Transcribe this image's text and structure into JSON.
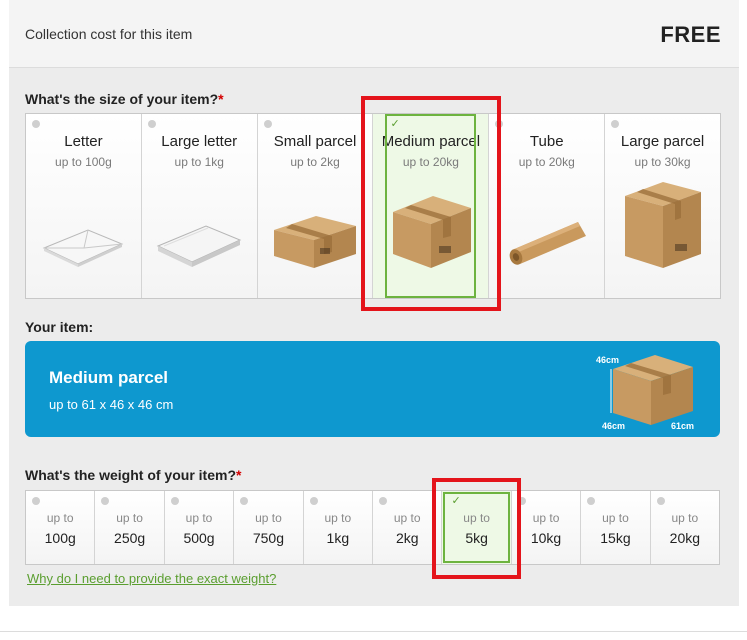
{
  "collection": {
    "label": "Collection cost for this item",
    "value": "FREE"
  },
  "size_section": {
    "title": "What's the size of your item?",
    "required_mark": "*"
  },
  "sizes": [
    {
      "name": "Letter",
      "limit": "up to 100g",
      "icon": "envelope-icon",
      "selected": false
    },
    {
      "name": "Large letter",
      "limit": "up to 1kg",
      "icon": "large-envelope-icon",
      "selected": false
    },
    {
      "name": "Small parcel",
      "limit": "up to 2kg",
      "icon": "small-box-icon",
      "selected": false
    },
    {
      "name": "Medium parcel",
      "limit": "up to 20kg",
      "icon": "medium-box-icon",
      "selected": true
    },
    {
      "name": "Tube",
      "limit": "up to 20kg",
      "icon": "tube-icon",
      "selected": false
    },
    {
      "name": "Large parcel",
      "limit": "up to 30kg",
      "icon": "large-box-icon",
      "selected": false
    }
  ],
  "your_item": {
    "title": "Your item:",
    "name": "Medium parcel",
    "dimensions": "up to 61 x 46 x 46 cm",
    "dim_height": "46cm",
    "dim_depth": "46cm",
    "dim_width": "61cm"
  },
  "weight_section": {
    "title": "What's the weight of your item?",
    "required_mark": "*"
  },
  "weights": [
    {
      "prefix": "up to",
      "value": "100g",
      "selected": false
    },
    {
      "prefix": "up to",
      "value": "250g",
      "selected": false
    },
    {
      "prefix": "up to",
      "value": "500g",
      "selected": false
    },
    {
      "prefix": "up to",
      "value": "750g",
      "selected": false
    },
    {
      "prefix": "up to",
      "value": "1kg",
      "selected": false
    },
    {
      "prefix": "up to",
      "value": "2kg",
      "selected": false
    },
    {
      "prefix": "up to",
      "value": "5kg",
      "selected": true
    },
    {
      "prefix": "up to",
      "value": "10kg",
      "selected": false
    },
    {
      "prefix": "up to",
      "value": "15kg",
      "selected": false
    },
    {
      "prefix": "up to",
      "value": "20kg",
      "selected": false
    }
  ],
  "why_link": "Why do I need to provide the exact weight?",
  "check_mark": "✓",
  "colors": {
    "accent_blue": "#0e98cf",
    "selected_green": "#6db33f",
    "highlight_red": "#e4141b",
    "required_red": "#d40000"
  }
}
